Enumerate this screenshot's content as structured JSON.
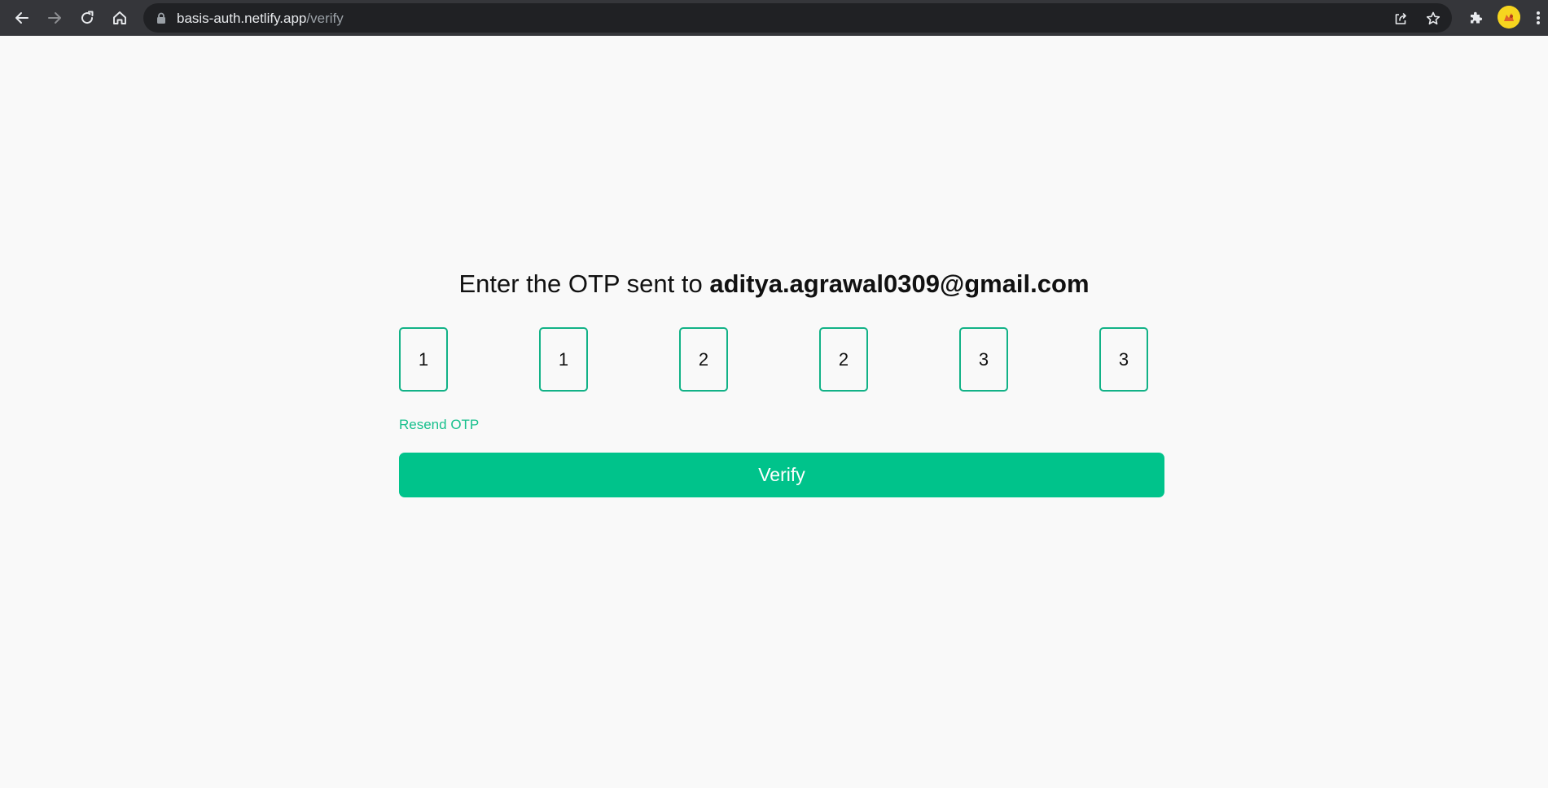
{
  "browser": {
    "url_host": "basis-auth.netlify.app",
    "url_path": "/verify",
    "icons": {
      "back": "arrow-left-icon",
      "forward": "arrow-right-icon",
      "reload": "reload-icon",
      "home": "home-icon",
      "lock": "lock-icon",
      "share": "share-icon",
      "bookmark": "star-icon",
      "extensions": "puzzle-icon",
      "menu": "kebab-menu-icon"
    }
  },
  "page": {
    "heading_prefix": "Enter the OTP sent to ",
    "email": "aditya.agrawal0309@gmail.com",
    "otp_digits": [
      "1",
      "1",
      "2",
      "2",
      "3",
      "3"
    ],
    "resend_label": "Resend OTP",
    "verify_label": "Verify"
  },
  "colors": {
    "accent": "#00c38b",
    "otp_border": "#12b287",
    "resend_text": "#17c08d",
    "page_bg": "#f9f9f9",
    "chrome_bg": "#35363a",
    "omnibox_bg": "#202124"
  }
}
